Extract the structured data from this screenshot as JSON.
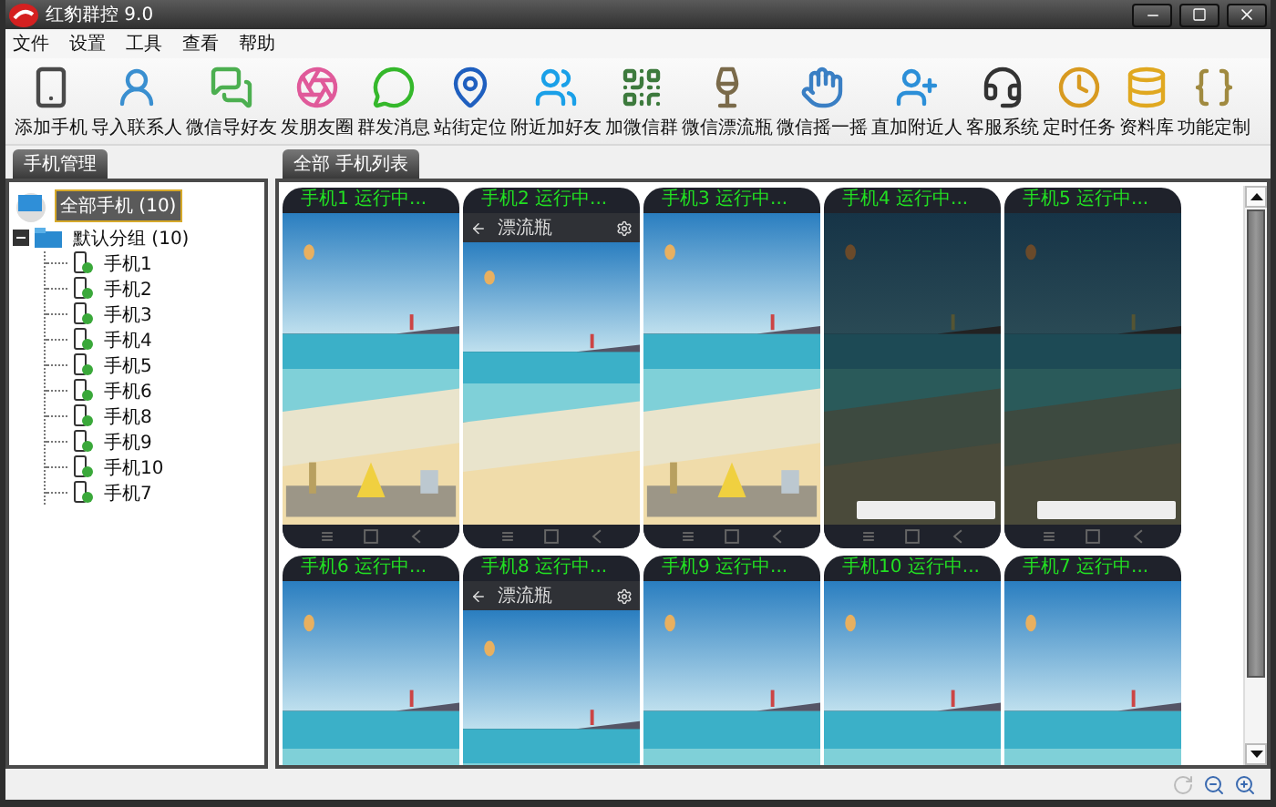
{
  "window": {
    "title": "红豹群控 9.0"
  },
  "menu": [
    "文件",
    "设置",
    "工具",
    "查看",
    "帮助"
  ],
  "toolbar": [
    "添加手机",
    "导入联系人",
    "微信导好友",
    "发朋友圈",
    "群发消息",
    "站街定位",
    "附近加好友",
    "加微信群",
    "微信漂流瓶",
    "微信摇一摇",
    "直加附近人",
    "客服系统",
    "定时任务",
    "资料库",
    "功能定制"
  ],
  "left_tab": {
    "label": "手机管理"
  },
  "tree": {
    "label": "全部手机 (10)",
    "selected": true,
    "children": [
      {
        "label": "默认分组 (10)",
        "selected": false,
        "expanded": true,
        "children": [
          {
            "label": "手机1",
            "selected": false
          },
          {
            "label": "手机2",
            "selected": false
          },
          {
            "label": "手机3",
            "selected": false
          },
          {
            "label": "手机4",
            "selected": false
          },
          {
            "label": "手机5",
            "selected": false
          },
          {
            "label": "手机6",
            "selected": false
          },
          {
            "label": "手机8",
            "selected": false
          },
          {
            "label": "手机9",
            "selected": false
          },
          {
            "label": "手机10",
            "selected": false
          },
          {
            "label": "手机7",
            "selected": false
          }
        ]
      }
    ]
  },
  "right_tab": {
    "label": "全部 手机列表"
  },
  "phones": [
    {
      "label": "手机1 运行中...",
      "kind": "home"
    },
    {
      "label": "手机2 运行中...",
      "kind": "app",
      "app_title": "漂流瓶"
    },
    {
      "label": "手机3 运行中...",
      "kind": "home"
    },
    {
      "label": "手机4 运行中...",
      "kind": "chat"
    },
    {
      "label": "手机5 运行中...",
      "kind": "chat"
    },
    {
      "label": "手机6 运行中...",
      "kind": "home"
    },
    {
      "label": "手机8 运行中...",
      "kind": "app",
      "app_title": "漂流瓶"
    },
    {
      "label": "手机9 运行中...",
      "kind": "home"
    },
    {
      "label": "手机10 运行中...",
      "kind": "home"
    },
    {
      "label": "手机7 运行中...",
      "kind": "home"
    }
  ]
}
